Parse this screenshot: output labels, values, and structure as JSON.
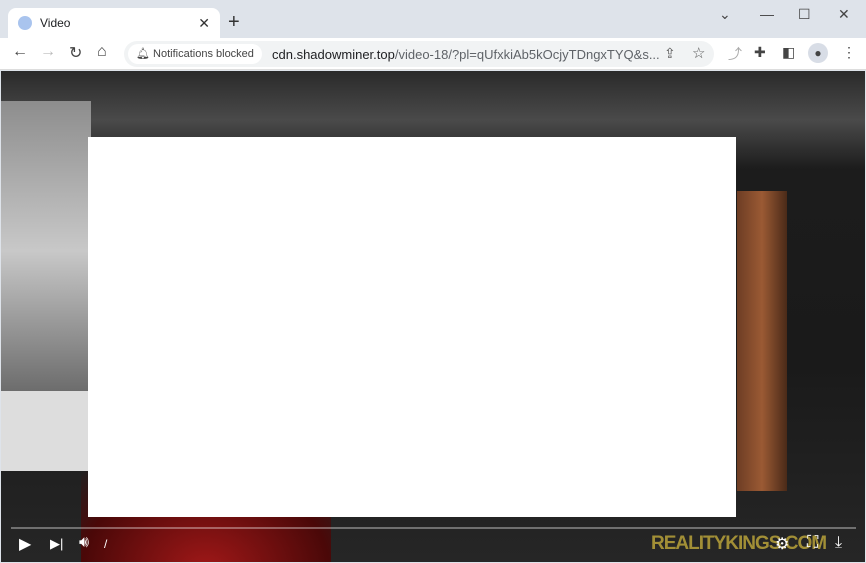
{
  "tab": {
    "title": "Video",
    "favicon": "video-favicon-icon"
  },
  "window_controls": [
    "chevron-down-icon",
    "minimize-icon",
    "maximize-icon",
    "close-icon"
  ],
  "toolbar": {
    "notification_chip": "Notifications blocked",
    "url_host": "cdn.shadowminer.top",
    "url_rest": "/video-18/?pl=qUfxkiAb5kOcjyTDngxTYQ&s..."
  },
  "player": {
    "time": "/",
    "progress": 0,
    "watermark": "REALITYKINGS.COM"
  }
}
